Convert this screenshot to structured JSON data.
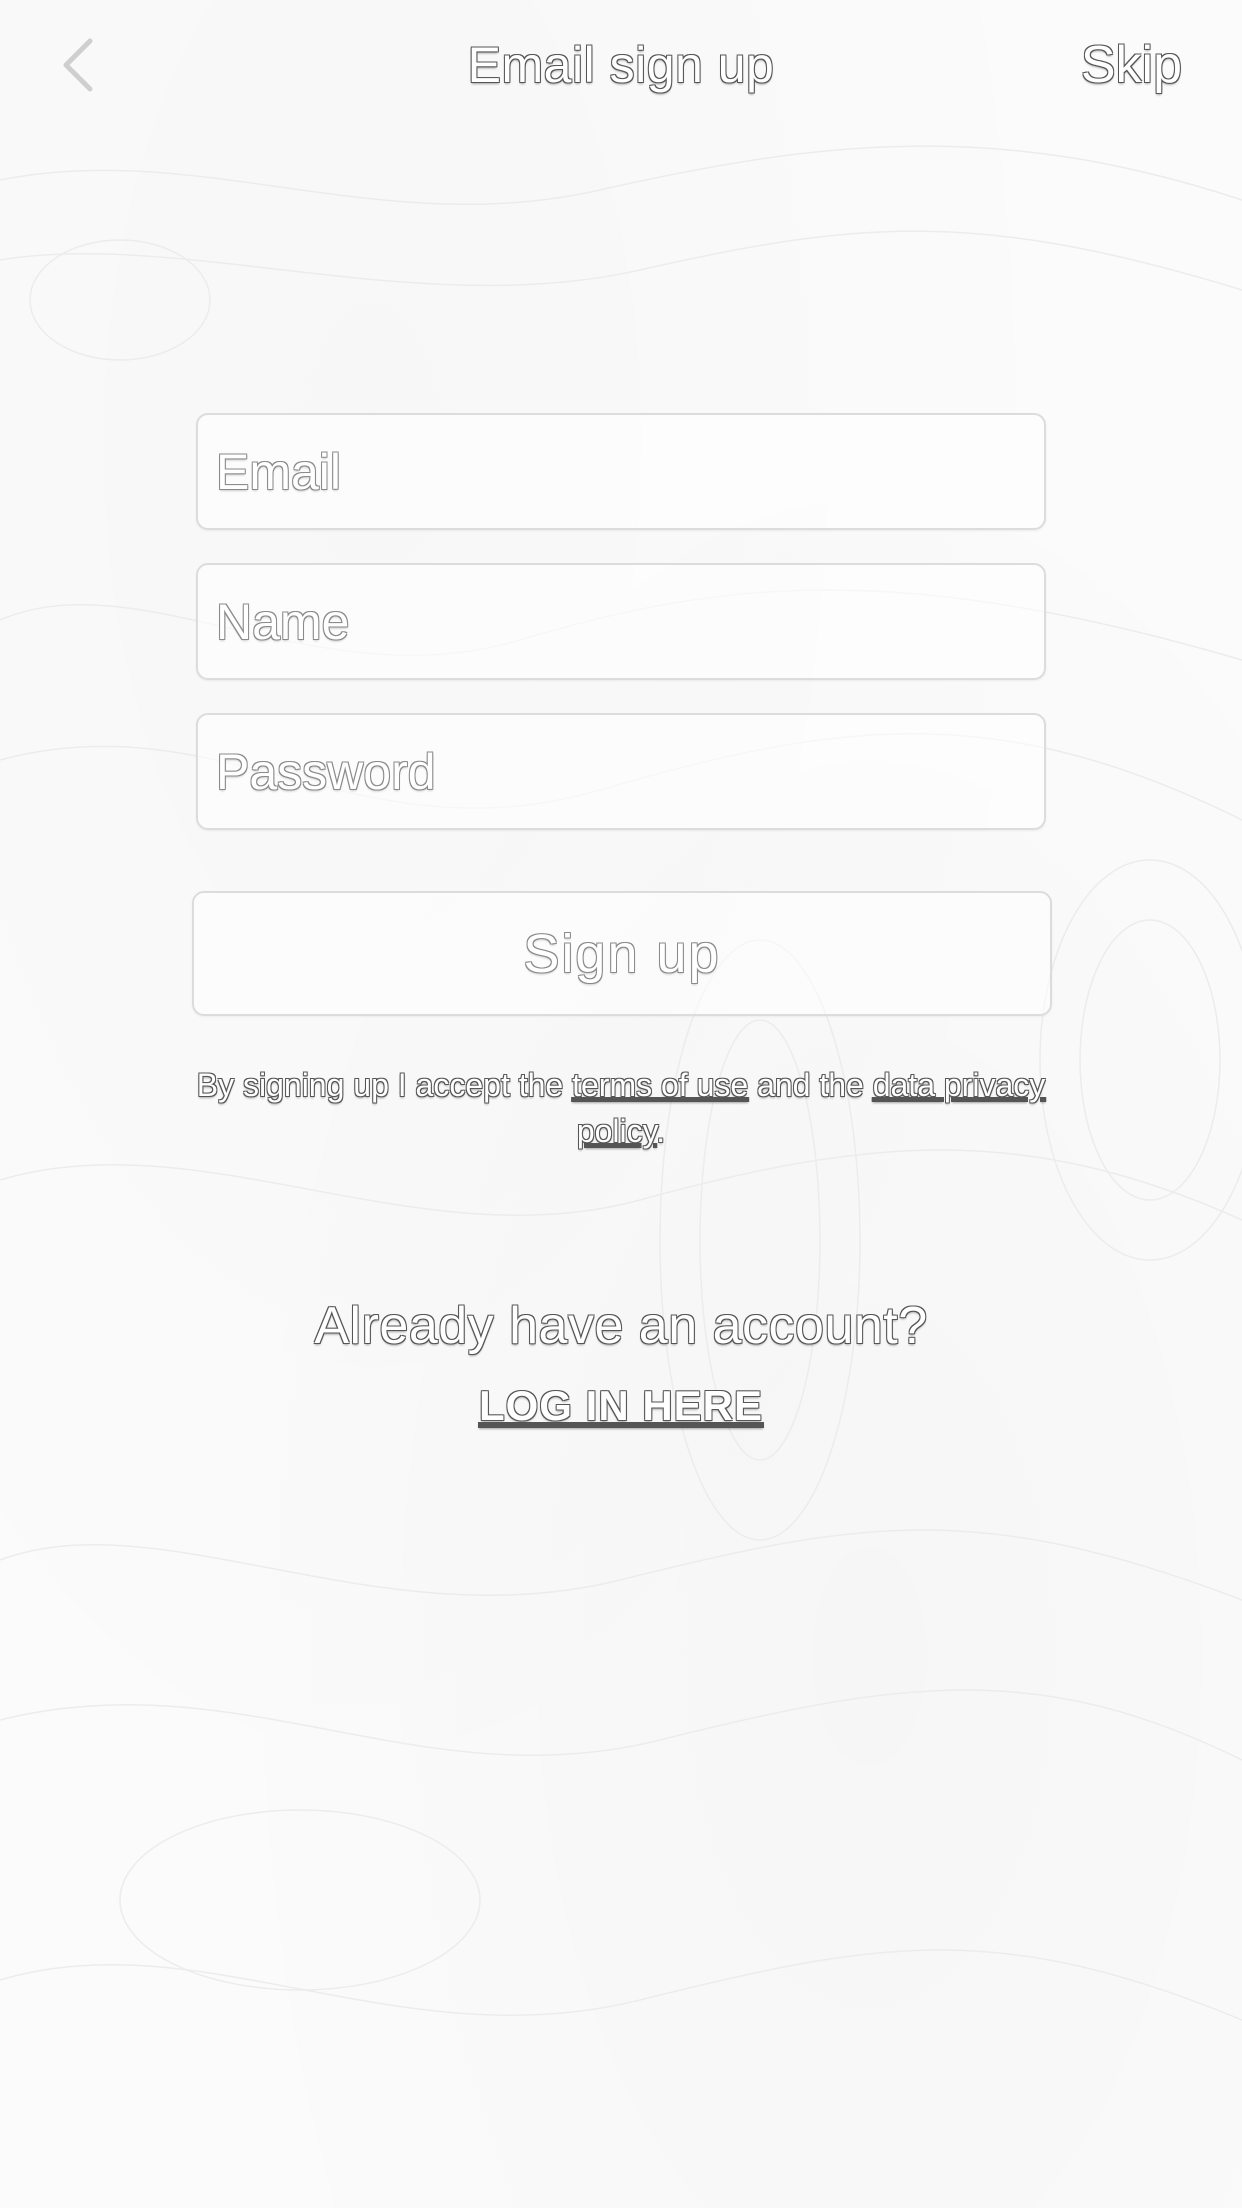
{
  "header": {
    "back_icon": "chevron-left-icon",
    "title": "Email sign up",
    "skip_label": "Skip"
  },
  "form": {
    "email": {
      "placeholder": "Email",
      "value": ""
    },
    "name": {
      "placeholder": "Name",
      "value": ""
    },
    "password": {
      "placeholder": "Password",
      "value": ""
    },
    "submit_label": "Sign up"
  },
  "terms": {
    "prefix": "By signing up I accept the ",
    "terms_link": "terms of use",
    "middle": " and the ",
    "policy_link": "data privacy policy",
    "suffix": "."
  },
  "login": {
    "prompt": "Already have an account?",
    "link_label": "LOG IN HERE"
  },
  "colors": {
    "background": "#fbfbfb",
    "field_border": "#dcdcdc",
    "text_outline": "#555555"
  }
}
